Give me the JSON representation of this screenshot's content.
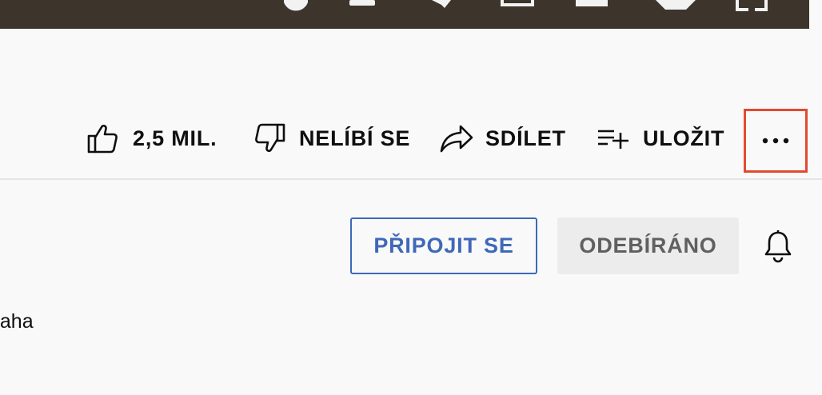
{
  "actions": {
    "like": {
      "label": "2,5 MIL.",
      "icon": "thumbs-up-icon"
    },
    "dislike": {
      "label": "NELÍBÍ SE",
      "icon": "thumbs-down-icon"
    },
    "share": {
      "label": "SDÍLET",
      "icon": "share-arrow-icon"
    },
    "save": {
      "label": "ULOŽIT",
      "icon": "playlist-add-icon"
    },
    "more": {
      "icon": "more-horizontal-icon",
      "highlight_color": "#e24a30"
    }
  },
  "channel": {
    "join_label": "PŘIPOJIT SE",
    "subscribed_label": "ODEBÍRÁNO",
    "bell_icon": "notification-bell-icon",
    "description_fragment": "naha"
  },
  "colors": {
    "background": "#f9f9f9",
    "player": "#3d342c",
    "join_accent": "#3f68b8",
    "subscribed_bg": "#ececec",
    "subscribed_text": "#606060",
    "highlight": "#e24a30"
  }
}
